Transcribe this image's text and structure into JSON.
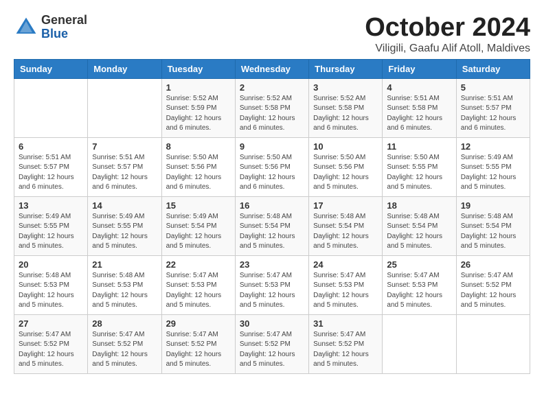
{
  "logo": {
    "general": "General",
    "blue": "Blue"
  },
  "title": "October 2024",
  "subtitle": "Viligili, Gaafu Alif Atoll, Maldives",
  "days_header": [
    "Sunday",
    "Monday",
    "Tuesday",
    "Wednesday",
    "Thursday",
    "Friday",
    "Saturday"
  ],
  "weeks": [
    [
      {
        "num": "",
        "content": ""
      },
      {
        "num": "",
        "content": ""
      },
      {
        "num": "1",
        "content": "Sunrise: 5:52 AM\nSunset: 5:59 PM\nDaylight: 12 hours and 6 minutes."
      },
      {
        "num": "2",
        "content": "Sunrise: 5:52 AM\nSunset: 5:58 PM\nDaylight: 12 hours and 6 minutes."
      },
      {
        "num": "3",
        "content": "Sunrise: 5:52 AM\nSunset: 5:58 PM\nDaylight: 12 hours and 6 minutes."
      },
      {
        "num": "4",
        "content": "Sunrise: 5:51 AM\nSunset: 5:58 PM\nDaylight: 12 hours and 6 minutes."
      },
      {
        "num": "5",
        "content": "Sunrise: 5:51 AM\nSunset: 5:57 PM\nDaylight: 12 hours and 6 minutes."
      }
    ],
    [
      {
        "num": "6",
        "content": "Sunrise: 5:51 AM\nSunset: 5:57 PM\nDaylight: 12 hours and 6 minutes."
      },
      {
        "num": "7",
        "content": "Sunrise: 5:51 AM\nSunset: 5:57 PM\nDaylight: 12 hours and 6 minutes."
      },
      {
        "num": "8",
        "content": "Sunrise: 5:50 AM\nSunset: 5:56 PM\nDaylight: 12 hours and 6 minutes."
      },
      {
        "num": "9",
        "content": "Sunrise: 5:50 AM\nSunset: 5:56 PM\nDaylight: 12 hours and 6 minutes."
      },
      {
        "num": "10",
        "content": "Sunrise: 5:50 AM\nSunset: 5:56 PM\nDaylight: 12 hours and 5 minutes."
      },
      {
        "num": "11",
        "content": "Sunrise: 5:50 AM\nSunset: 5:55 PM\nDaylight: 12 hours and 5 minutes."
      },
      {
        "num": "12",
        "content": "Sunrise: 5:49 AM\nSunset: 5:55 PM\nDaylight: 12 hours and 5 minutes."
      }
    ],
    [
      {
        "num": "13",
        "content": "Sunrise: 5:49 AM\nSunset: 5:55 PM\nDaylight: 12 hours and 5 minutes."
      },
      {
        "num": "14",
        "content": "Sunrise: 5:49 AM\nSunset: 5:55 PM\nDaylight: 12 hours and 5 minutes."
      },
      {
        "num": "15",
        "content": "Sunrise: 5:49 AM\nSunset: 5:54 PM\nDaylight: 12 hours and 5 minutes."
      },
      {
        "num": "16",
        "content": "Sunrise: 5:48 AM\nSunset: 5:54 PM\nDaylight: 12 hours and 5 minutes."
      },
      {
        "num": "17",
        "content": "Sunrise: 5:48 AM\nSunset: 5:54 PM\nDaylight: 12 hours and 5 minutes."
      },
      {
        "num": "18",
        "content": "Sunrise: 5:48 AM\nSunset: 5:54 PM\nDaylight: 12 hours and 5 minutes."
      },
      {
        "num": "19",
        "content": "Sunrise: 5:48 AM\nSunset: 5:54 PM\nDaylight: 12 hours and 5 minutes."
      }
    ],
    [
      {
        "num": "20",
        "content": "Sunrise: 5:48 AM\nSunset: 5:53 PM\nDaylight: 12 hours and 5 minutes."
      },
      {
        "num": "21",
        "content": "Sunrise: 5:48 AM\nSunset: 5:53 PM\nDaylight: 12 hours and 5 minutes."
      },
      {
        "num": "22",
        "content": "Sunrise: 5:47 AM\nSunset: 5:53 PM\nDaylight: 12 hours and 5 minutes."
      },
      {
        "num": "23",
        "content": "Sunrise: 5:47 AM\nSunset: 5:53 PM\nDaylight: 12 hours and 5 minutes."
      },
      {
        "num": "24",
        "content": "Sunrise: 5:47 AM\nSunset: 5:53 PM\nDaylight: 12 hours and 5 minutes."
      },
      {
        "num": "25",
        "content": "Sunrise: 5:47 AM\nSunset: 5:53 PM\nDaylight: 12 hours and 5 minutes."
      },
      {
        "num": "26",
        "content": "Sunrise: 5:47 AM\nSunset: 5:52 PM\nDaylight: 12 hours and 5 minutes."
      }
    ],
    [
      {
        "num": "27",
        "content": "Sunrise: 5:47 AM\nSunset: 5:52 PM\nDaylight: 12 hours and 5 minutes."
      },
      {
        "num": "28",
        "content": "Sunrise: 5:47 AM\nSunset: 5:52 PM\nDaylight: 12 hours and 5 minutes."
      },
      {
        "num": "29",
        "content": "Sunrise: 5:47 AM\nSunset: 5:52 PM\nDaylight: 12 hours and 5 minutes."
      },
      {
        "num": "30",
        "content": "Sunrise: 5:47 AM\nSunset: 5:52 PM\nDaylight: 12 hours and 5 minutes."
      },
      {
        "num": "31",
        "content": "Sunrise: 5:47 AM\nSunset: 5:52 PM\nDaylight: 12 hours and 5 minutes."
      },
      {
        "num": "",
        "content": ""
      },
      {
        "num": "",
        "content": ""
      }
    ]
  ]
}
